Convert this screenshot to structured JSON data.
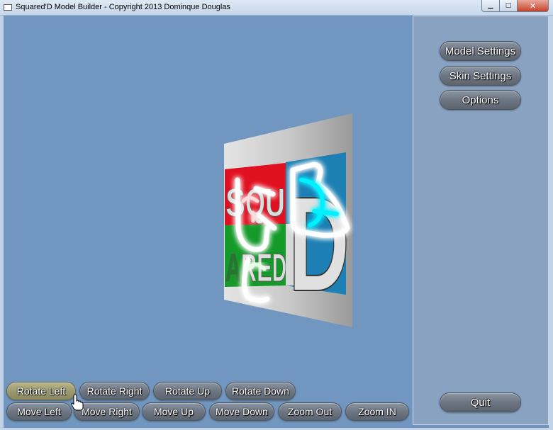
{
  "window": {
    "title": "Squared'D Model Builder - Copyright 2013 Dominque Douglas",
    "controls": [
      "minimize",
      "maximize",
      "close"
    ]
  },
  "model": {
    "tiles": {
      "row1": [
        "S",
        "Q",
        "U"
      ],
      "row2": [
        "A",
        "R",
        "E",
        "D"
      ],
      "big_letter": "D"
    },
    "colors": {
      "background": "#7196c0",
      "card": "#c8c8c8",
      "red": "#e01020",
      "green": "#159a2a",
      "blue": "#1d7fb4",
      "glow_cyan": "#00f0ff"
    }
  },
  "side_panel": {
    "model_settings": "Model Settings",
    "skin_settings": "Skin Settings",
    "options": "Options",
    "quit": "Quit"
  },
  "toolbar": {
    "rotate_left": "Rotate Left",
    "rotate_right": "Rotate Right",
    "rotate_up": "Rotate Up",
    "rotate_down": "Rotate Down",
    "move_left": "Move Left",
    "move_right": "Move Right",
    "move_up": "Move Up",
    "move_down": "Move Down",
    "zoom_out": "Zoom Out",
    "zoom_in": "Zoom IN",
    "active_button": "rotate_left"
  },
  "icons": {
    "cursor": "hand-pointer-icon",
    "app": "window-app-icon"
  }
}
